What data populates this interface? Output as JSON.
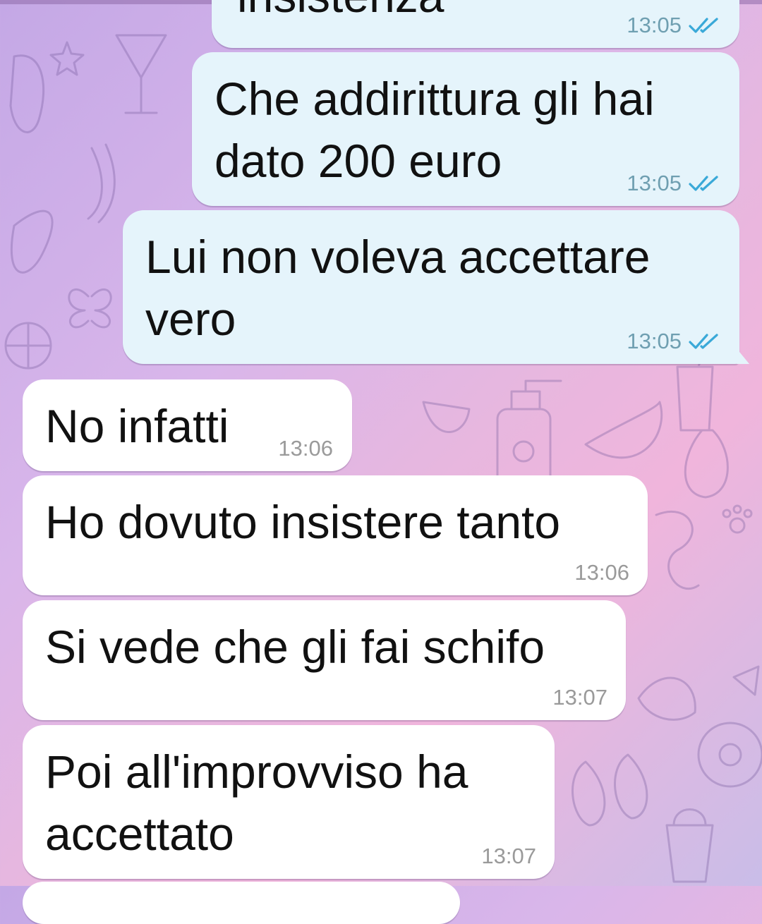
{
  "chat": {
    "messages": [
      {
        "id": "m1",
        "direction": "outgoing",
        "text": "insistenza",
        "time": "13:05",
        "status": "read"
      },
      {
        "id": "m2",
        "direction": "outgoing",
        "text": "Che addirittura gli hai\ndato 200 euro",
        "time": "13:05",
        "status": "read"
      },
      {
        "id": "m3",
        "direction": "outgoing",
        "text": "Lui non voleva accettare\nvero",
        "time": "13:05",
        "status": "read"
      },
      {
        "id": "m4",
        "direction": "incoming",
        "text": "No infatti",
        "time": "13:06"
      },
      {
        "id": "m5",
        "direction": "incoming",
        "text": "Ho dovuto insistere tanto",
        "time": "13:06"
      },
      {
        "id": "m6",
        "direction": "incoming",
        "text": "Si vede che gli fai schifo",
        "time": "13:07"
      },
      {
        "id": "m7",
        "direction": "incoming",
        "text": "Poi all'improvviso ha\naccettato",
        "time": "13:07"
      }
    ]
  },
  "colors": {
    "outgoing_bubble": "#e5f4fb",
    "incoming_bubble": "#ffffff",
    "read_check": "#3aa9d8"
  },
  "icons": {
    "read_status": "double-check-icon",
    "wallpaper": "doodle-pattern"
  }
}
